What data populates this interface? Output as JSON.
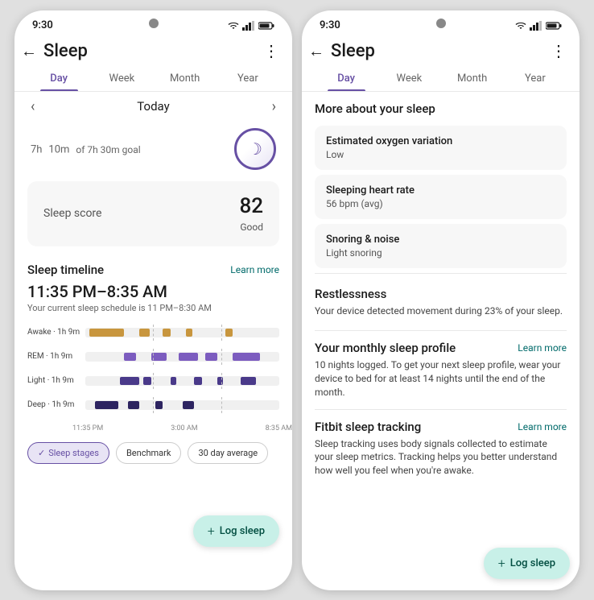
{
  "colors": {
    "accent": "#6750a4",
    "teal": "#006a6a",
    "fab_bg": "#c8f0e8",
    "fab_text": "#004d40",
    "awake": "#c8963e",
    "rem": "#7c5cbf",
    "light": "#4a3a8a",
    "deep": "#2d2460"
  },
  "left_phone": {
    "status": {
      "time": "9:30"
    },
    "header": {
      "back_label": "←",
      "title": "Sleep",
      "more_icon": "⋮"
    },
    "tabs": [
      {
        "label": "Day",
        "active": true
      },
      {
        "label": "Week",
        "active": false
      },
      {
        "label": "Month",
        "active": false
      },
      {
        "label": "Year",
        "active": false
      }
    ],
    "nav": {
      "prev": "‹",
      "label": "Today",
      "next": "›"
    },
    "sleep_duration": {
      "hours": "7h",
      "minutes": "10m",
      "goal_text": "of 7h 30m goal"
    },
    "sleep_score": {
      "label": "Sleep score",
      "value": "82",
      "quality": "Good"
    },
    "timeline": {
      "title": "Sleep timeline",
      "learn_more": "Learn more",
      "range": "11:35 PM–8:35 AM",
      "schedule_note": "Your current sleep schedule is 11 PM–8:30 AM",
      "rows": [
        {
          "label": "Awake · 1h 9m"
        },
        {
          "label": "REM · 1h 9m"
        },
        {
          "label": "Light · 1h 9m"
        },
        {
          "label": "Deep · 1h 9m"
        }
      ],
      "time_labels": [
        "11:35 PM",
        "3:00 AM",
        "8:35 AM"
      ]
    },
    "pills": [
      {
        "label": "Sleep stages",
        "active": true,
        "icon": "✓"
      },
      {
        "label": "Benchmark",
        "active": false
      },
      {
        "label": "30 day average",
        "active": false
      }
    ],
    "fab": {
      "plus": "+",
      "label": "Log sleep"
    }
  },
  "right_phone": {
    "status": {
      "time": "9:30"
    },
    "header": {
      "back_label": "←",
      "title": "Sleep",
      "more_icon": "⋮"
    },
    "tabs": [
      {
        "label": "Day",
        "active": true
      },
      {
        "label": "Week",
        "active": false
      },
      {
        "label": "Month",
        "active": false
      },
      {
        "label": "Year",
        "active": false
      }
    ],
    "more_about": {
      "title": "More about your sleep",
      "cards": [
        {
          "title": "Estimated oxygen variation",
          "value": "Low"
        },
        {
          "title": "Sleeping heart rate",
          "value": "56 bpm (avg)"
        },
        {
          "title": "Snoring & noise",
          "value": "Light snoring"
        }
      ]
    },
    "restlessness": {
      "title": "Restlessness",
      "desc": "Your device detected movement during 23% of your sleep."
    },
    "monthly_profile": {
      "title": "Your monthly sleep profile",
      "learn_more": "Learn more",
      "desc": "10 nights logged. To get your next sleep profile, wear your device to bed for at least 14 nights until the end of the month."
    },
    "fitbit": {
      "title": "Fitbit sleep tracking",
      "learn_more": "Learn more",
      "desc": "Sleep tracking uses body signals collected to estimate your sleep metrics. Tracking helps you better understand how well you feel when you're awake."
    },
    "fab": {
      "plus": "+",
      "label": "Log sleep"
    }
  }
}
